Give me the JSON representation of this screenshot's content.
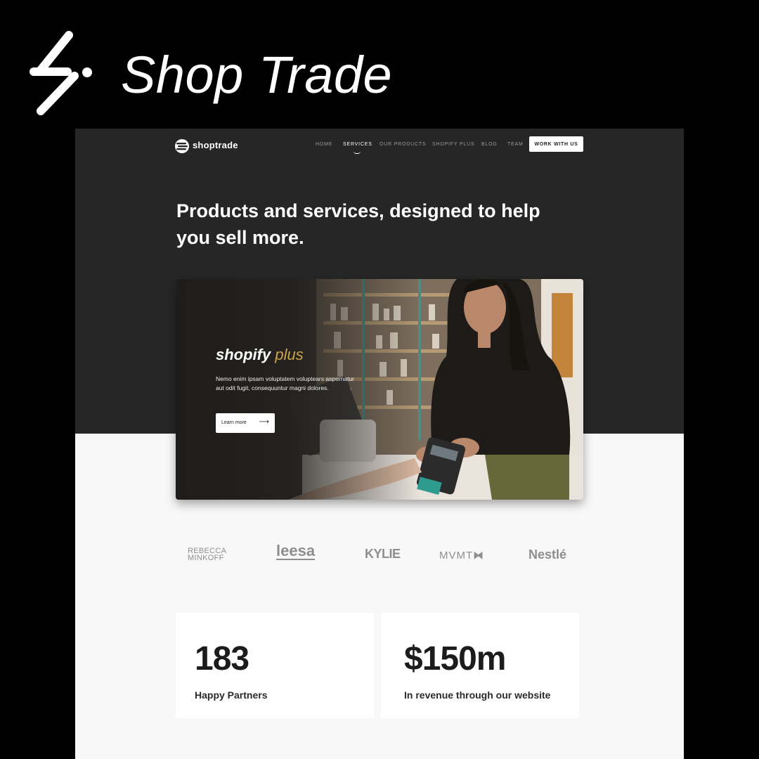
{
  "brand": {
    "title": "Shop Trade"
  },
  "nav": {
    "logo_text": "shoptrade",
    "links": [
      {
        "label": "HOME",
        "active": false
      },
      {
        "label": "SERVICES",
        "active": true
      },
      {
        "label": "OUR PRODUCTS",
        "active": false
      },
      {
        "label": "SHOPIFY PLUS",
        "active": false
      },
      {
        "label": "BLOG",
        "active": false
      },
      {
        "label": "TEAM",
        "active": false
      }
    ],
    "cta_label": "WORK WITH US"
  },
  "hero": {
    "headline": "Products and services, designed to help you sell more."
  },
  "feature_card": {
    "brand_word_1": "shopify",
    "brand_word_2": "plus",
    "description": "Nemo enim ipsam voluptatem voluptears aspernatur aut odit fugit, consequuntur magni dolores.",
    "button_label": "Learn more",
    "button_icon": "arrow-right-icon"
  },
  "client_logos": [
    {
      "name": "REBECCA MINKOFF",
      "line1": "REBECCA",
      "line2": "MINKOFF"
    },
    {
      "name": "leesa"
    },
    {
      "name": "KYLIE"
    },
    {
      "name": "MVMT"
    },
    {
      "name": "Nestlé"
    }
  ],
  "stats": [
    {
      "value": "183",
      "label": "Happy Partners"
    },
    {
      "value": "$150m",
      "label": "In revenue through our website"
    }
  ],
  "colors": {
    "background": "#000000",
    "hero_dark": "#262626",
    "page_light": "#f8f8f8",
    "accent_gold": "#c9a44b"
  }
}
